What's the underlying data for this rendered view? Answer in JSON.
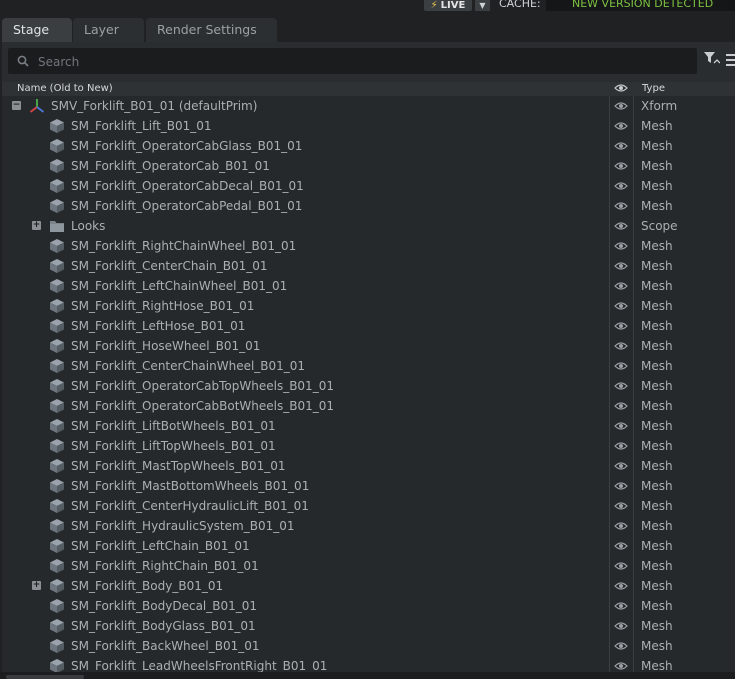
{
  "topbar": {
    "live_label": "LIVE",
    "cache_label": "CACHE:",
    "cache_status": "NEW VERSION DETECTED"
  },
  "tabs": [
    {
      "label": "Stage",
      "active": true
    },
    {
      "label": "Layer",
      "active": false
    },
    {
      "label": "Render Settings",
      "active": false
    }
  ],
  "search": {
    "placeholder": "Search",
    "value": ""
  },
  "columns": {
    "name": "Name (Old to New)",
    "type": "Type"
  },
  "rows": [
    {
      "name": "SMV_Forklift_B01_01 (defaultPrim)",
      "type": "Xform",
      "icon": "xform-axis-icon",
      "depth": 0,
      "expander": "collapse"
    },
    {
      "name": "SM_Forklift_Lift_B01_01",
      "type": "Mesh",
      "icon": "mesh-cube-icon",
      "depth": 1,
      "expander": ""
    },
    {
      "name": "SM_Forklift_OperatorCabGlass_B01_01",
      "type": "Mesh",
      "icon": "mesh-cube-icon",
      "depth": 1,
      "expander": ""
    },
    {
      "name": "SM_Forklift_OperatorCab_B01_01",
      "type": "Mesh",
      "icon": "mesh-cube-icon",
      "depth": 1,
      "expander": ""
    },
    {
      "name": "SM_Forklift_OperatorCabDecal_B01_01",
      "type": "Mesh",
      "icon": "mesh-cube-icon",
      "depth": 1,
      "expander": ""
    },
    {
      "name": "SM_Forklift_OperatorCabPedal_B01_01",
      "type": "Mesh",
      "icon": "mesh-cube-icon",
      "depth": 1,
      "expander": ""
    },
    {
      "name": "Looks",
      "type": "Scope",
      "icon": "folder-icon",
      "depth": 1,
      "expander": "expand"
    },
    {
      "name": "SM_Forklift_RightChainWheel_B01_01",
      "type": "Mesh",
      "icon": "mesh-cube-icon",
      "depth": 1,
      "expander": ""
    },
    {
      "name": "SM_Forklift_CenterChain_B01_01",
      "type": "Mesh",
      "icon": "mesh-cube-icon",
      "depth": 1,
      "expander": ""
    },
    {
      "name": "SM_Forklift_LeftChainWheel_B01_01",
      "type": "Mesh",
      "icon": "mesh-cube-icon",
      "depth": 1,
      "expander": ""
    },
    {
      "name": "SM_Forklift_RightHose_B01_01",
      "type": "Mesh",
      "icon": "mesh-cube-icon",
      "depth": 1,
      "expander": ""
    },
    {
      "name": "SM_Forklift_LeftHose_B01_01",
      "type": "Mesh",
      "icon": "mesh-cube-icon",
      "depth": 1,
      "expander": ""
    },
    {
      "name": "SM_Forklift_HoseWheel_B01_01",
      "type": "Mesh",
      "icon": "mesh-cube-icon",
      "depth": 1,
      "expander": ""
    },
    {
      "name": "SM_Forklift_CenterChainWheel_B01_01",
      "type": "Mesh",
      "icon": "mesh-cube-icon",
      "depth": 1,
      "expander": ""
    },
    {
      "name": "SM_Forklift_OperatorCabTopWheels_B01_01",
      "type": "Mesh",
      "icon": "mesh-cube-icon",
      "depth": 1,
      "expander": ""
    },
    {
      "name": "SM_Forklift_OperatorCabBotWheels_B01_01",
      "type": "Mesh",
      "icon": "mesh-cube-icon",
      "depth": 1,
      "expander": ""
    },
    {
      "name": "SM_Forklift_LiftBotWheels_B01_01",
      "type": "Mesh",
      "icon": "mesh-cube-icon",
      "depth": 1,
      "expander": ""
    },
    {
      "name": "SM_Forklift_LiftTopWheels_B01_01",
      "type": "Mesh",
      "icon": "mesh-cube-icon",
      "depth": 1,
      "expander": ""
    },
    {
      "name": "SM_Forklift_MastTopWheels_B01_01",
      "type": "Mesh",
      "icon": "mesh-cube-icon",
      "depth": 1,
      "expander": ""
    },
    {
      "name": "SM_Forklift_MastBottomWheels_B01_01",
      "type": "Mesh",
      "icon": "mesh-cube-icon",
      "depth": 1,
      "expander": ""
    },
    {
      "name": "SM_Forklift_CenterHydraulicLift_B01_01",
      "type": "Mesh",
      "icon": "mesh-cube-icon",
      "depth": 1,
      "expander": ""
    },
    {
      "name": "SM_Forklift_HydraulicSystem_B01_01",
      "type": "Mesh",
      "icon": "mesh-cube-icon",
      "depth": 1,
      "expander": ""
    },
    {
      "name": "SM_Forklift_LeftChain_B01_01",
      "type": "Mesh",
      "icon": "mesh-cube-icon",
      "depth": 1,
      "expander": ""
    },
    {
      "name": "SM_Forklift_RightChain_B01_01",
      "type": "Mesh",
      "icon": "mesh-cube-icon",
      "depth": 1,
      "expander": ""
    },
    {
      "name": "SM_Forklift_Body_B01_01",
      "type": "Mesh",
      "icon": "mesh-cube-icon",
      "depth": 1,
      "expander": "expand"
    },
    {
      "name": "SM_Forklift_BodyDecal_B01_01",
      "type": "Mesh",
      "icon": "mesh-cube-icon",
      "depth": 1,
      "expander": ""
    },
    {
      "name": "SM_Forklift_BodyGlass_B01_01",
      "type": "Mesh",
      "icon": "mesh-cube-icon",
      "depth": 1,
      "expander": ""
    },
    {
      "name": "SM_Forklift_BackWheel_B01_01",
      "type": "Mesh",
      "icon": "mesh-cube-icon",
      "depth": 1,
      "expander": ""
    },
    {
      "name": "SM_Forklift_LeadWheelsFrontRight_B01_01",
      "type": "Mesh",
      "icon": "mesh-cube-icon",
      "depth": 1,
      "expander": ""
    }
  ],
  "colors": {
    "accent_green": "#7cc242",
    "live_bolt": "#f2c94c"
  }
}
